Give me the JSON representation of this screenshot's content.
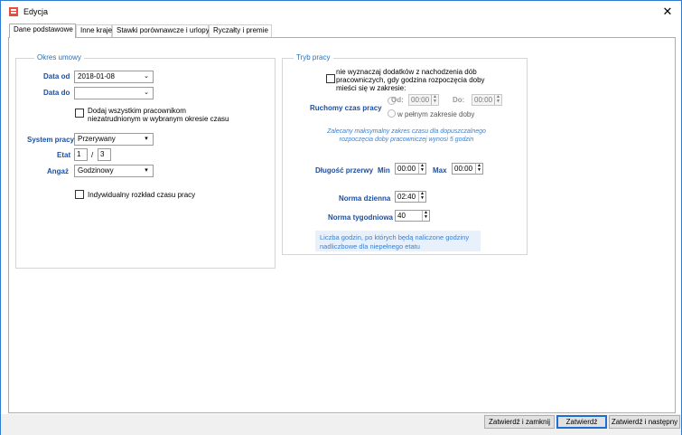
{
  "window": {
    "title": "Edycja",
    "close_glyph": "✕"
  },
  "tabs": [
    "Dane podstawowe",
    "Inne kraje",
    "Stawki porównawcze i urlopy",
    "Ryczałty i premie"
  ],
  "okres": {
    "legend": "Okres umowy",
    "data_od_label": "Data od",
    "data_od_value": "2018-01-08",
    "data_do_label": "Data do",
    "data_do_value": "",
    "dodaj_line1": "Dodaj wszystkim pracownikom",
    "dodaj_line2": "niezatrudnionym w wybranym okresie czasu",
    "system_label": "System pracy",
    "system_value": "Przerywany",
    "etat_label": "Etat",
    "etat_num": "1",
    "etat_sep": "/",
    "etat_den": "3",
    "angaz_label": "Angaż",
    "angaz_value": "Godzinowy",
    "indywidualny": "Indywidualny rozkład czasu pracy"
  },
  "tryb": {
    "legend": "Tryb pracy",
    "nie_line1": "nie wyznaczaj dodatków z nachodzenia dób",
    "nie_line2": "pracowniczych, gdy godzina rozpoczęcia doby",
    "nie_line3": "mieści się w zakresie:",
    "ruchomy_label": "Ruchomy czas pracy",
    "od_label": "Od:",
    "od_value": "00:00",
    "do_label": "Do:",
    "do_value": "00:00",
    "pelny": "w pełnym zakresie doby",
    "zalecany_line1": "Zalecany maksymalny zakres czasu dla dopuszczalnego",
    "zalecany_line2": "rozpoczęcia doby pracowniczej wynosi 5 godzin",
    "dlugosc_label": "Długość przerwy",
    "min_label": "Min",
    "min_value": "00:00",
    "max_label": "Max",
    "max_value": "00:00",
    "norma_dzienna_label": "Norma dzienna",
    "norma_dzienna_value": "02:40",
    "norma_tyg_label": "Norma tygodniowa",
    "norma_tyg_value": "40",
    "liczba_line1": "Liczba godzin, po których będą naliczone godziny",
    "liczba_line2": "nadliczbowe dla niepełnego etatu"
  },
  "buttons": {
    "zatwierdz_zamknij": "Zatwierdź i zamknij",
    "zatwierdz": "Zatwierdź",
    "zatwierdz_nastepny": "Zatwierdź i następny"
  },
  "colors": {
    "accent": "#1d4fa0",
    "legend": "#2e6fb5",
    "info": "#3b7fd0",
    "border": "#2f7bd1"
  }
}
